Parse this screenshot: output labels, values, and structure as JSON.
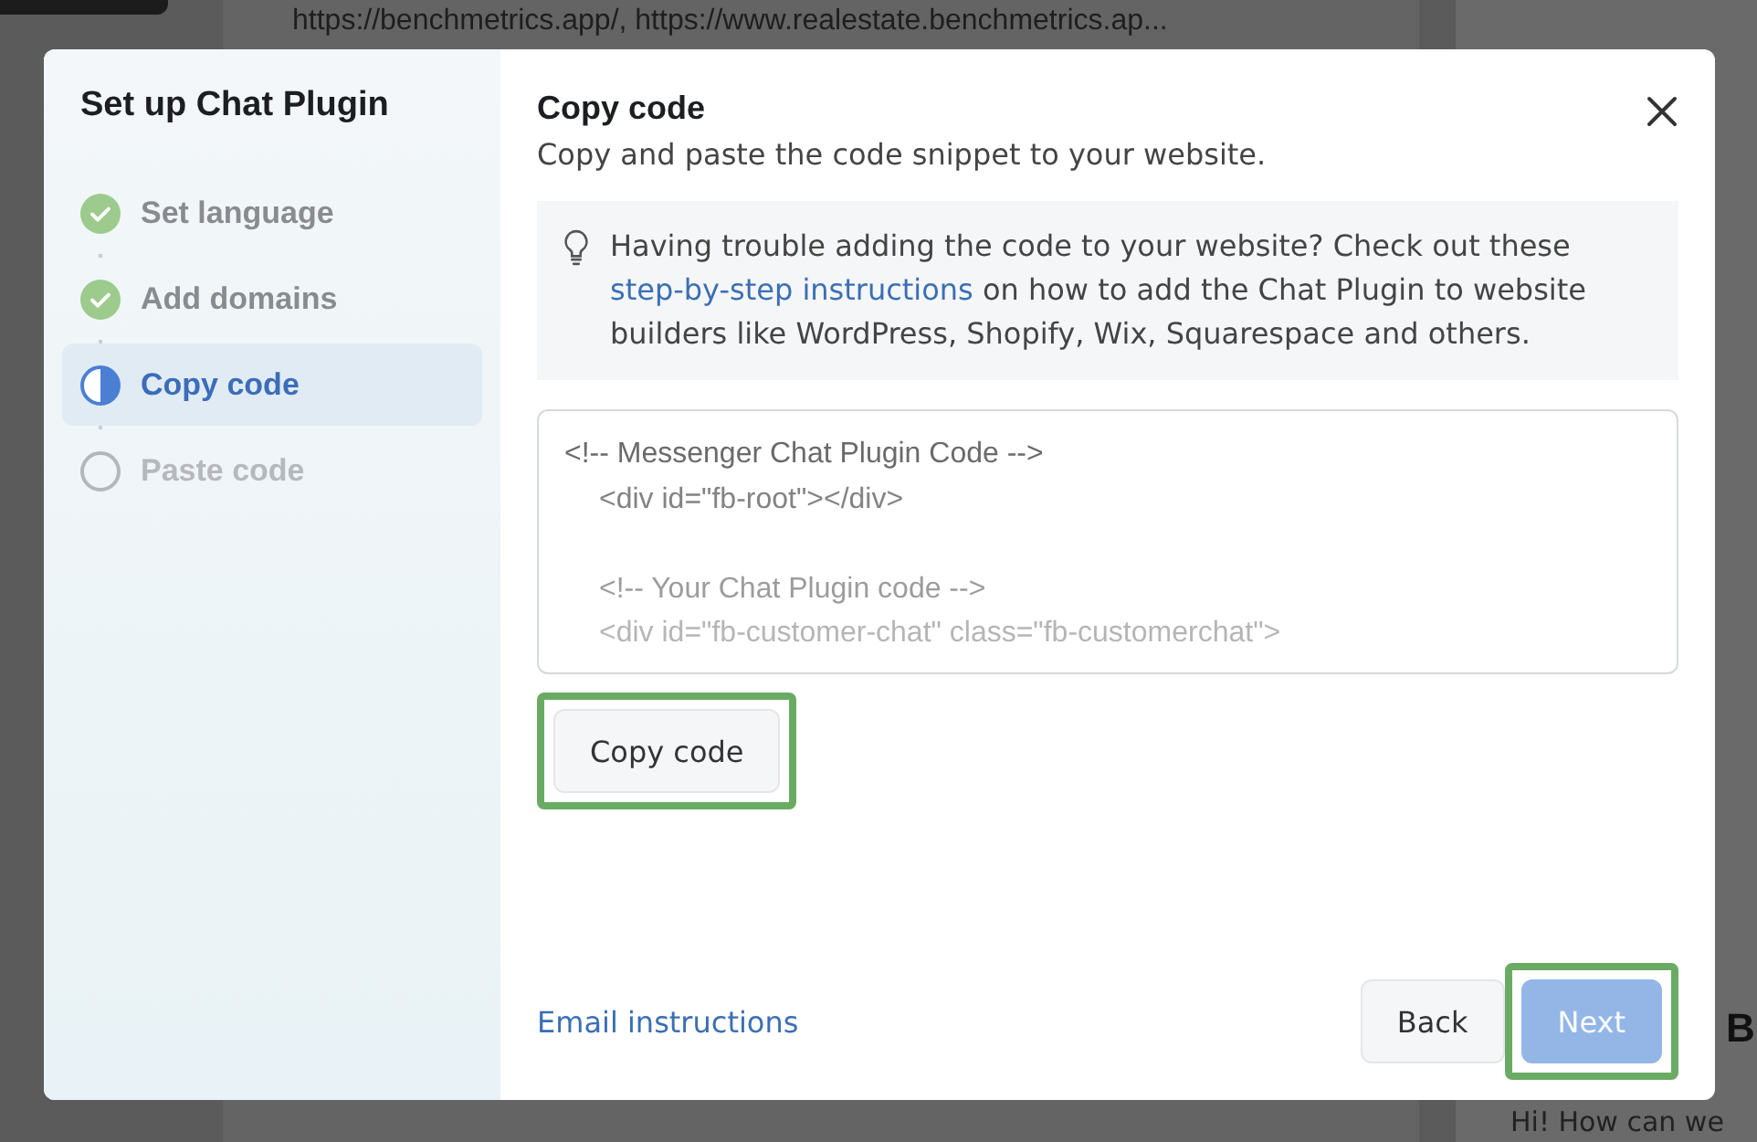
{
  "background": {
    "url_text": "https://benchmetrics.app/, https://www.realestate.benchmetrics.ap...",
    "side_heading": "B",
    "chat_preview": "Hi! How can we"
  },
  "dialog": {
    "sidebar": {
      "title": "Set up Chat Plugin",
      "steps": [
        {
          "label": "Set language",
          "kind": "done",
          "selected": false
        },
        {
          "label": "Add domains",
          "kind": "done",
          "selected": false
        },
        {
          "label": "Copy code",
          "kind": "current",
          "selected": true
        },
        {
          "label": "Paste code",
          "kind": "todo",
          "selected": false
        }
      ]
    },
    "title": "Copy code",
    "subtitle": "Copy and paste the code snippet to your website.",
    "tip": {
      "before": "Having trouble adding the code to your website? Check out these ",
      "link": "step-by-step instructions",
      "after": " on how to add the Chat Plugin to website builders like WordPress, Shopify, Wix, Squarespace and others."
    },
    "code_lines": [
      {
        "text": "<!-- Messenger Chat Plugin Code -->",
        "indented": false
      },
      {
        "text": "<div id=\"fb-root\"></div>",
        "indented": true
      },
      {
        "text": "<!-- Your Chat Plugin code -->",
        "indented": true,
        "gap_before": true
      },
      {
        "text": "<div id=\"fb-customer-chat\" class=\"fb-customerchat\">",
        "indented": true
      }
    ],
    "copy_button": {
      "label": "Copy code",
      "highlighted": true
    },
    "email_link": "Email instructions",
    "buttons": [
      {
        "label": "Back",
        "disabled": false,
        "highlighted": false
      },
      {
        "label": "Next",
        "disabled": true,
        "highlighted": true
      }
    ]
  }
}
